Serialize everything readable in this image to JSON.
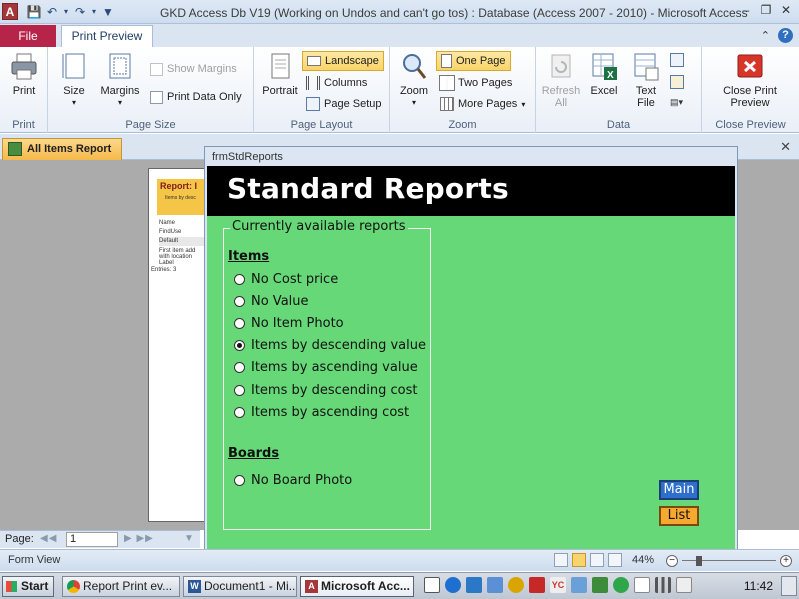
{
  "window": {
    "title": "GKD Access Db V19 (Working on Undos and can't go tos) : Database (Access 2007 - 2010)  -  Microsoft Access",
    "app_icon_letter": "A"
  },
  "ribbon_tabs": {
    "file": "File",
    "print_preview": "Print Preview"
  },
  "ribbon": {
    "print": {
      "print_label": "Print",
      "group": "Print"
    },
    "page_size": {
      "size_label": "Size",
      "margins_label": "Margins",
      "show_margins_label": "Show Margins",
      "print_data_only_label": "Print Data Only",
      "group": "Page Size"
    },
    "page_layout": {
      "portrait_label": "Portrait",
      "landscape_label": "Landscape",
      "columns_label": "Columns",
      "page_setup_label": "Page Setup",
      "group": "Page Layout"
    },
    "zoom": {
      "zoom_label": "Zoom",
      "one_page_label": "One Page",
      "two_pages_label": "Two Pages",
      "more_pages_label": "More Pages",
      "group": "Zoom"
    },
    "data": {
      "refresh_all_label_1": "Refresh",
      "refresh_all_label_2": "All",
      "excel_label": "Excel",
      "text_file_label_1": "Text",
      "text_file_label_2": "File",
      "group": "Data"
    },
    "close": {
      "close_label_1": "Close Print",
      "close_label_2": "Preview",
      "group": "Close Preview"
    }
  },
  "doc_tab": {
    "label": "All Items Report"
  },
  "page_preview": {
    "title": "Report: I",
    "subtitle": "Items by desc",
    "lines": [
      "Name",
      "FindUse",
      "Default",
      "First item add",
      "with location",
      "Label",
      "Entries: 3"
    ]
  },
  "popup": {
    "title": "frmStdReports",
    "header": "Standard Reports",
    "frame_legend": "Currently available reports",
    "items_heading": "Items",
    "items_options": [
      {
        "label": "No Cost price",
        "selected": false
      },
      {
        "label": "No Value",
        "selected": false
      },
      {
        "label": "No Item Photo",
        "selected": false
      },
      {
        "label": "Items by descending value",
        "selected": true
      },
      {
        "label": "Items by ascending value",
        "selected": false
      },
      {
        "label": "Items by descending cost",
        "selected": false
      },
      {
        "label": "Items by ascending cost",
        "selected": false
      }
    ],
    "boards_heading": "Boards",
    "boards_options": [
      {
        "label": "No Board Photo",
        "selected": false
      }
    ],
    "main_button": "Main",
    "list_button": "List"
  },
  "navbar": {
    "page_label": "Page:",
    "page_value": "1"
  },
  "statusbar": {
    "view_label": "Form View",
    "zoom": "44%"
  },
  "taskbar": {
    "start": "Start",
    "items": [
      "Report Print ev...",
      "Document1 - Mi...",
      "Microsoft Acc..."
    ],
    "clock": "11:42"
  },
  "colors": {
    "file_tab": "#b6244a",
    "form_green": "#66d877",
    "main_button": "#2e6fc9",
    "list_button": "#f7a82f",
    "selection": "#f9d468"
  }
}
